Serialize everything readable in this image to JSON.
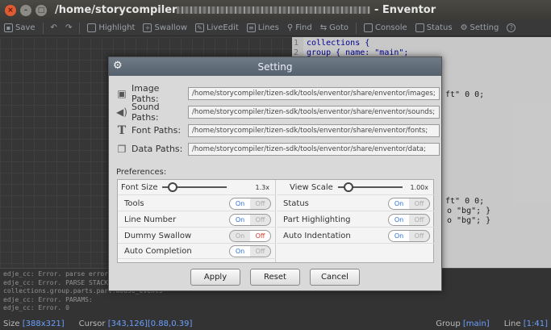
{
  "window": {
    "title_prefix": "/home/storycompiler",
    "title_suffix": " - Enventor"
  },
  "toolbar": {
    "save": "Save",
    "highlight": "Highlight",
    "swallow": "Swallow",
    "liveedit": "LiveEdit",
    "lines": "Lines",
    "find": "Find",
    "goto": "Goto",
    "console": "Console",
    "status": "Status",
    "setting": "Setting",
    "help": "?"
  },
  "editor": {
    "lines": [
      {
        "num": "1",
        "text": "collections {"
      },
      {
        "num": "2",
        "text": "   group { name: \"main\";"
      }
    ],
    "fragments": {
      "ft1": "ft\" 0 0;",
      "ft2": "ft\" 0 0;",
      "bg1": "o \"bg\"; }",
      "bg2": "o \"bg\"; }"
    }
  },
  "console": {
    "lines": [
      "edje_cc: Error. parse error /hom",
      "edje_cc: Error. PARSE STACK:",
      "collections.group.parts.part.mouse_events",
      "edje_cc: Error. PARAMS:",
      "edje_cc: Error.    0"
    ]
  },
  "status": {
    "size_label": "Size",
    "size_value": "[388x321]",
    "cursor_label": "Cursor",
    "cursor_value": "[343,126][0.88,0.39]",
    "group_label": "Group",
    "group_value": "[main]",
    "line_label": "Line",
    "line_value": "[1:41]"
  },
  "dialog": {
    "title": "Setting",
    "paths": [
      {
        "icon": "image-icon",
        "label": "Image Paths:",
        "value": "/home/storycompiler/tizen-sdk/tools/enventor/share/enventor/images;"
      },
      {
        "icon": "sound-icon",
        "label": "Sound Paths:",
        "value": "/home/storycompiler/tizen-sdk/tools/enventor/share/enventor/sounds;"
      },
      {
        "icon": "font-icon",
        "label": "Font Paths:",
        "value": "/home/storycompiler/tizen-sdk/tools/enventor/share/enventor/fonts;"
      },
      {
        "icon": "data-icon",
        "label": "Data Paths:",
        "value": "/home/storycompiler/tizen-sdk/tools/enventor/share/enventor/data;"
      }
    ],
    "preferences_label": "Preferences:",
    "font_size": {
      "label": "Font Size",
      "value": "1.3x",
      "level": 0.1
    },
    "view_scale": {
      "label": "View Scale",
      "value": "1.00x",
      "level": 0.1
    },
    "toggle_on": "On",
    "toggle_off": "Off",
    "left_prefs": [
      {
        "label": "Tools",
        "state": "on"
      },
      {
        "label": "Line Number",
        "state": "on"
      },
      {
        "label": "Dummy Swallow",
        "state": "off"
      },
      {
        "label": "Auto Completion",
        "state": "on"
      }
    ],
    "right_prefs": [
      {
        "label": "Status",
        "state": "on"
      },
      {
        "label": "Part Highlighting",
        "state": "on"
      },
      {
        "label": "Auto Indentation",
        "state": "on"
      }
    ],
    "buttons": {
      "apply": "Apply",
      "reset": "Reset",
      "cancel": "Cancel"
    }
  }
}
